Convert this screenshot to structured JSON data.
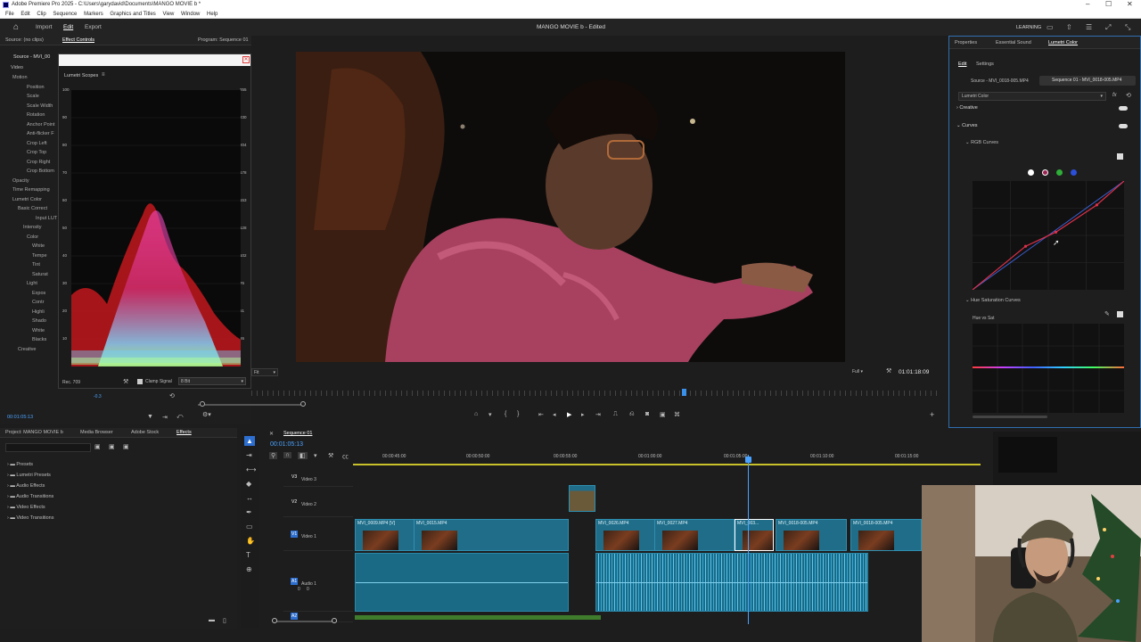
{
  "window": {
    "title": "Adobe Premiere Pro 2025 - C:\\Users\\garydavid\\Documents\\MANGO MOVIE b *"
  },
  "menu": [
    "File",
    "Edit",
    "Clip",
    "Sequence",
    "Markers",
    "Graphics and Titles",
    "View",
    "Window",
    "Help"
  ],
  "app": {
    "tabs": [
      "Import",
      "Edit",
      "Export"
    ],
    "active_tab": "Edit",
    "project_title": "MANGO MOVIE b",
    "project_status": "- Edited",
    "workspace_label": "LEARNING"
  },
  "left_panel": {
    "tabs": [
      "Source: (no clips)",
      "Effect Controls",
      "Program: Sequence 01"
    ],
    "source_label": "Source - MVI_00",
    "video_label": "Video",
    "effects": [
      "Motion",
      "Position",
      "Scale",
      "Scale Width",
      "Rotation",
      "Anchor Point",
      "Anti-flicker F",
      "Crop Left",
      "Crop Top",
      "Crop Right",
      "Crop Bottom",
      "Opacity",
      "Time Remapping",
      "Lumetri Color",
      "Basic Correct",
      "Input LUT",
      "Intensity",
      "Color",
      "White",
      "Tempe",
      "Tint",
      "Saturat",
      "Light",
      "Expos",
      "Contr",
      "Highli",
      "Shado",
      "White",
      "Blacks",
      "Creative"
    ],
    "timecode": "00:01:05:13"
  },
  "scopes": {
    "title": "Lumetri Scopes",
    "left_scale": [
      "100",
      "90",
      "80",
      "70",
      "60",
      "50",
      "40",
      "30",
      "20",
      "10"
    ],
    "right_scale": [
      "255",
      "230",
      "204",
      "178",
      "153",
      "128",
      "102",
      "76",
      "51",
      "26"
    ],
    "color_space": "Rec. 709",
    "clamp_label": "Clamp Signal",
    "bit_depth": "8 Bit",
    "value": "-0.3"
  },
  "program": {
    "fit_label": "Fit",
    "quality": "Full",
    "timecode": "01:01:18:09"
  },
  "lumetri": {
    "tabs": [
      "Properties",
      "Essential Sound",
      "Lumetri Color"
    ],
    "subtabs": [
      "Edit",
      "Settings"
    ],
    "source_clip": "Source - MVI_0018-005.MP4",
    "sequence_clip": "Sequence 01 - MVI_0018-005.MP4",
    "effect_select": "Lumetri Color",
    "sections": [
      "Creative",
      "Curves",
      "RGB Curves",
      "Hue Saturation Curves",
      "Hue vs Sat"
    ],
    "channel_colors": [
      "#ffffff",
      "#e23a3a",
      "#2fae3a",
      "#2b4fd9"
    ],
    "curve_points": [
      [
        0,
        0
      ],
      [
        0.35,
        0.4
      ],
      [
        0.55,
        0.53
      ],
      [
        0.82,
        0.78
      ],
      [
        1,
        1
      ]
    ]
  },
  "project_panel": {
    "tabs": [
      "Project: MANGO MOVIE b",
      "Media Browser",
      "Adobe Stock",
      "Effects"
    ],
    "items": [
      "Presets",
      "Lumetri Presets",
      "Audio Effects",
      "Audio Transitions",
      "Video Effects",
      "Video Transitions"
    ]
  },
  "timeline": {
    "sequence_tab": "Sequence 01",
    "timecode": "00:01:05:13",
    "ruler": [
      "00:00:45:00",
      "00:00:50:00",
      "00:00:55:00",
      "00:01:00:00",
      "00:01:05:00",
      "00:01:10:00",
      "00:01:15:00"
    ],
    "tracks": [
      {
        "id": "V3",
        "name": "Video 3"
      },
      {
        "id": "V2",
        "name": "Video 2"
      },
      {
        "id": "V1",
        "name": "Video 1"
      },
      {
        "id": "A1",
        "name": "Audio 1"
      },
      {
        "id": "A2",
        "name": ""
      }
    ],
    "clips": [
      "MVI_0009.MP4 [V]",
      "MVI_0015.MP4",
      "MVI_0026.MP4",
      "MVI_0027.MP4",
      "MVI_003...",
      "MVI_0018-005.MP4",
      "MVI_0018-005.MP4"
    ],
    "audio_levels": [
      "0",
      "0"
    ]
  }
}
